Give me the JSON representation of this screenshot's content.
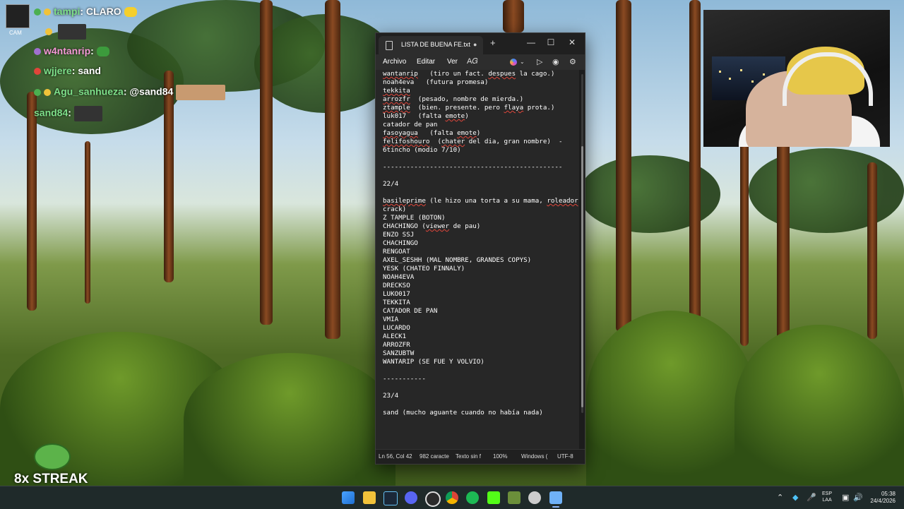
{
  "chat": {
    "cam_label": "CAM",
    "lines": [
      {
        "user": "tampi",
        "sep": ": ",
        "text": "CLARO"
      },
      {
        "user": "",
        "sep": "",
        "text": ""
      },
      {
        "user": "w4ntanrip",
        "sep": ": ",
        "text": ""
      },
      {
        "user": "wjjere",
        "sep": ": ",
        "text": "sand"
      },
      {
        "user": "Agu_sanhueza",
        "sep": ": ",
        "text": "@sand84"
      },
      {
        "user": "sand84",
        "sep": ": ",
        "text": ""
      }
    ],
    "streak": "8x STREAK"
  },
  "notepad": {
    "tab_title": "LISTA DE BUENA FE.txt",
    "unsaved_dot": "●",
    "add_tab": "+",
    "menu": {
      "file": "Archivo",
      "edit": "Editar",
      "view": "Ver"
    },
    "lines": [
      "wantanrip   (tiro un fact. despues la cago.)",
      "noah4eva   (futura promesa)",
      "tekkita",
      "arrozfr  (pesado, nombre de mierda.)",
      "ztample  (bien. presente. pero flaya prota.)",
      "luk017   (falta emote)",
      "catador de pan",
      "fasoyagua   (falta emote)",
      "felifoshouro  (chater del dia, gran nombre)  -",
      "6tincho (modio 7/10)",
      "",
      "----------------------------------------------",
      "",
      "22/4",
      "",
      "basileprime (le hizo una torta a su mama, roleador",
      "crack)",
      "Z TAMPLE (BOTON)",
      "CHACHINGO (viewer de pau)",
      "ENZO SSJ",
      "CHACHINGO",
      "RENGOAT",
      "AXEL_SESHH (MAL NOMBRE, GRANDES COPYS)",
      "YESK (CHATEO FINNALY)",
      "NOAH4EVA",
      "DRECKSO",
      "LUKO017",
      "TEKKITA",
      "CATADOR DE PAN",
      "VMIA",
      "LUCARDO",
      "ALECK1",
      "ARROZFR",
      "SANZUBTW",
      "WANTARIP (SE FUE Y VOLVIO)",
      "",
      "-----------",
      "",
      "23/4",
      "",
      "sand (mucho aguante cuando no había nada)"
    ],
    "status": {
      "position": "Ln 56, Col 42",
      "chars": "982 caracte",
      "format": "Texto sin f",
      "zoom": "100%",
      "eol": "Windows (",
      "encoding": "UTF-8"
    }
  },
  "taskbar": {
    "lang_top": "ESP",
    "lang_bottom": "LAA",
    "time": "05:38",
    "date": "24/4/2026"
  }
}
